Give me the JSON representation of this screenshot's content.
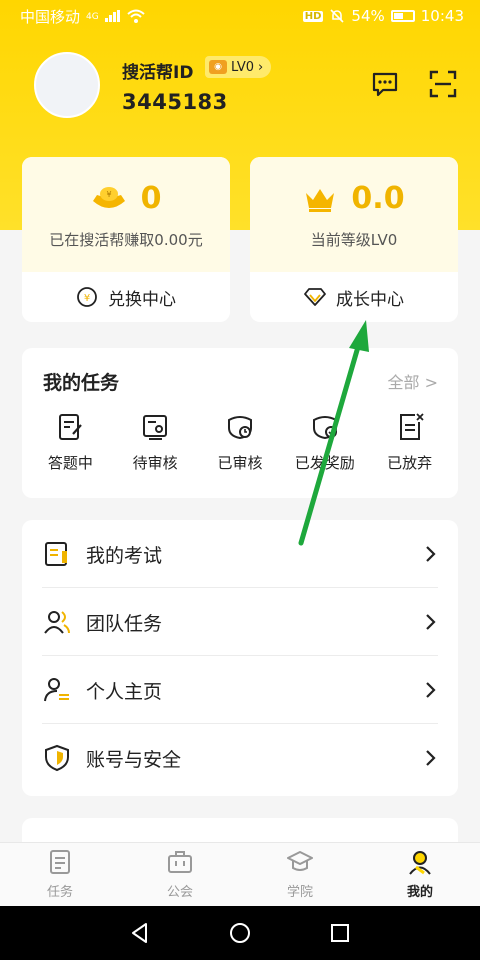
{
  "status_bar": {
    "carrier": "中国移动",
    "network": "4G",
    "hd": "HD",
    "battery": "54%",
    "time": "10:43"
  },
  "profile": {
    "id_label": "搜活帮ID",
    "level_badge": "LV0",
    "user_id": "3445183",
    "top_icons": [
      "message-icon",
      "scan-icon"
    ]
  },
  "stats": {
    "earnings": {
      "value": "0",
      "caption": "已在搜活帮赚取0.00元",
      "button": "兑换中心",
      "icon": "gold-ingot-icon"
    },
    "level": {
      "value": "0.0",
      "caption": "当前等级LV0",
      "button": "成长中心",
      "icon": "crown-icon"
    }
  },
  "tasks": {
    "title": "我的任务",
    "all_link": "全部 >",
    "items": [
      {
        "label": "答题中",
        "icon": "edit-note-icon"
      },
      {
        "label": "待审核",
        "icon": "review-pending-icon"
      },
      {
        "label": "已审核",
        "icon": "reviewed-icon"
      },
      {
        "label": "已发奖励",
        "icon": "reward-icon"
      },
      {
        "label": "已放弃",
        "icon": "abandoned-icon"
      }
    ]
  },
  "menu": {
    "items": [
      {
        "label": "我的考试",
        "icon": "exam-icon"
      },
      {
        "label": "团队任务",
        "icon": "team-icon"
      },
      {
        "label": "个人主页",
        "icon": "profile-icon"
      },
      {
        "label": "账号与安全",
        "icon": "shield-icon"
      }
    ]
  },
  "tabbar": {
    "items": [
      {
        "label": "任务",
        "icon": "task-list-icon",
        "active": false
      },
      {
        "label": "公会",
        "icon": "briefcase-icon",
        "active": false
      },
      {
        "label": "学院",
        "icon": "graduation-cap-icon",
        "active": false
      },
      {
        "label": "我的",
        "icon": "person-icon",
        "active": true
      }
    ]
  },
  "colors": {
    "brand_yellow": "#ffd600",
    "accent_gold": "#f0b400",
    "annotation_arrow": "#1ea83c"
  }
}
